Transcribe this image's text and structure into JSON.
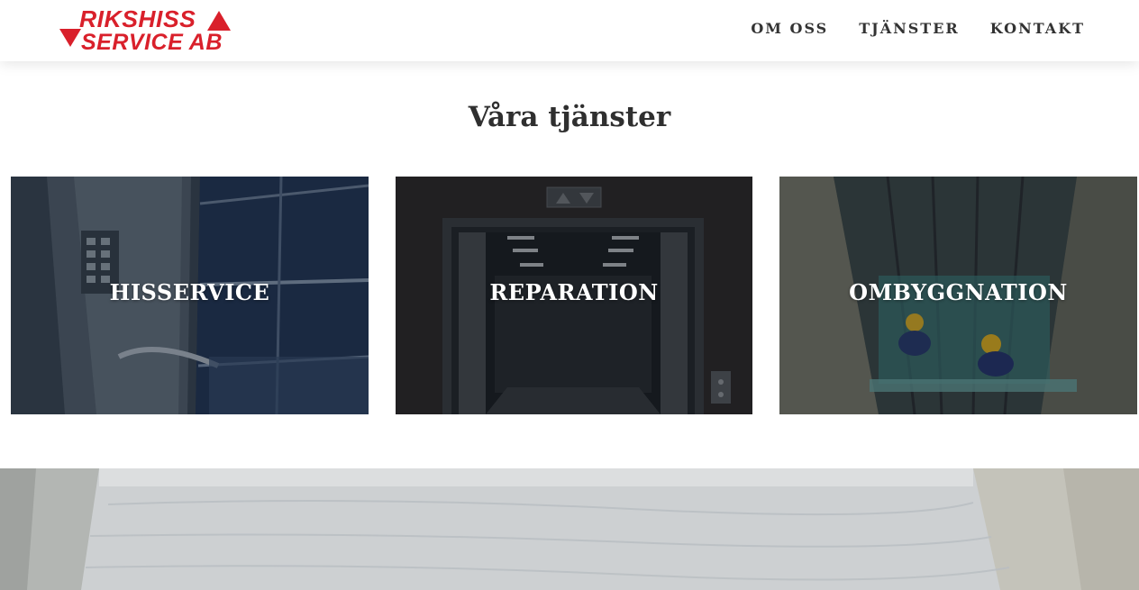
{
  "header": {
    "logo": {
      "line1": "RIKSHISS",
      "line2": "SERVICE AB",
      "color": "#d9202b"
    },
    "nav": [
      {
        "label": "OM OSS"
      },
      {
        "label": "TJÄNSTER"
      },
      {
        "label": "KONTAKT"
      }
    ]
  },
  "main": {
    "title": "Våra tjänster",
    "cards": [
      {
        "label": "HISSERVICE",
        "image": "elevator-interior-photo"
      },
      {
        "label": "REPARATION",
        "image": "elevator-doors-photo"
      },
      {
        "label": "OMBYGGNATION",
        "image": "elevator-shaft-workers-photo"
      }
    ]
  },
  "banner": {
    "image": "water-canal-photo"
  }
}
